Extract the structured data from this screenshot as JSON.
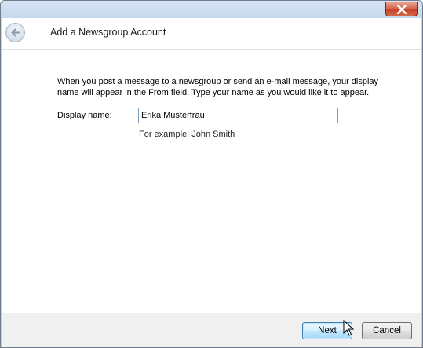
{
  "window": {
    "title": "Add a Newsgroup Account"
  },
  "icons": {
    "close": "close-icon",
    "back": "back-arrow-icon",
    "cursor": "mouse-pointer-icon"
  },
  "content": {
    "intro_line1": "When you post a message to a newsgroup or send an e-mail message, your display",
    "intro_line2": "name will appear in the From field.  Type your name as you would like it to appear.",
    "display_name_label": "Display name:",
    "display_name_value": "Erika Musterfrau",
    "example_text": "For example: John Smith"
  },
  "footer": {
    "next_label": "Next",
    "cancel_label": "Cancel"
  }
}
